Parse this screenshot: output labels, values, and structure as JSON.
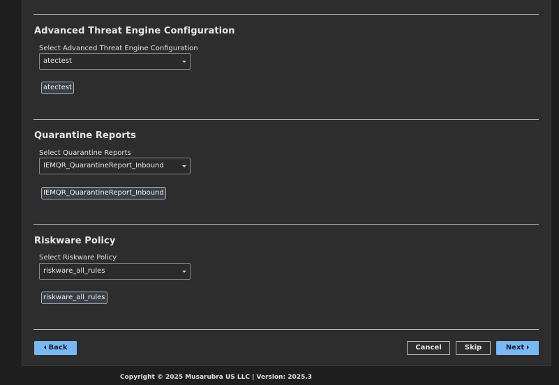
{
  "sections": [
    {
      "title": "Advanced Threat Engine Configuration",
      "field_label": "Select Advanced Threat Engine Configuration",
      "selected_value": "atectest",
      "tags": [
        "atectest"
      ]
    },
    {
      "title": "Quarantine Reports",
      "field_label": "Select Quarantine Reports",
      "selected_value": "IEMQR_QuarantineReport_Inbound",
      "tags": [
        "IEMQR_QuarantineReport_Inbound"
      ]
    },
    {
      "title": "Riskware Policy",
      "field_label": "Select Riskware Policy",
      "selected_value": "riskware_all_rules",
      "tags": [
        "riskware_all_rules"
      ]
    }
  ],
  "buttons": {
    "back": "Back",
    "cancel": "Cancel",
    "skip": "Skip",
    "next": "Next"
  },
  "icons": {
    "back": "triangle-left-icon",
    "next": "triangle-right-icon",
    "select": "caret-down-icon"
  },
  "footer": {
    "text": "Copyright © 2025 Musarubra US LLC | Version: 2025.3"
  },
  "colors": {
    "primary_button": "#7ab8f5",
    "panel_background": "#2d2d2d",
    "page_background": "#1f1f1f"
  }
}
